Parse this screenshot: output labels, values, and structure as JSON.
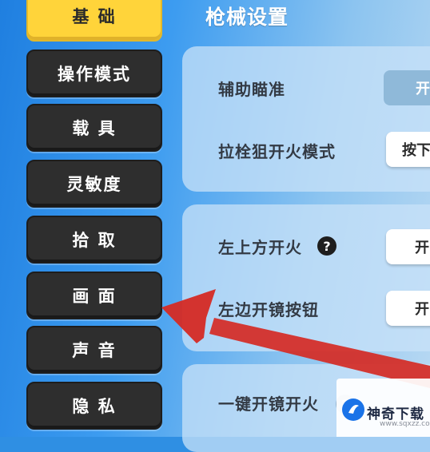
{
  "sidebar": {
    "items": [
      {
        "label": "基 础",
        "active": true
      },
      {
        "label": "操作模式",
        "active": false
      },
      {
        "label": "载 具",
        "active": false
      },
      {
        "label": "灵敏度",
        "active": false
      },
      {
        "label": "拾 取",
        "active": false
      },
      {
        "label": "画 面",
        "active": false
      },
      {
        "label": "声 音",
        "active": false
      },
      {
        "label": "隐 私",
        "active": false
      }
    ]
  },
  "main": {
    "title": "枪械设置",
    "settings": [
      {
        "label": "辅助瞄准",
        "value": "开"
      },
      {
        "label": "拉栓狙开火模式",
        "value": "按下"
      },
      {
        "label": "左上方开火",
        "value": "开"
      },
      {
        "label": "左边开镜按钮",
        "value": "开"
      },
      {
        "label": "一键开镜开火",
        "value": ""
      }
    ],
    "help_glyph": "?"
  },
  "watermark": {
    "text": "神奇下载",
    "url": "www.sqxzz.com"
  },
  "colors": {
    "active_tab": "#ffd43a",
    "inactive_tab": "#2e2e2e",
    "arrow": "#d52a24"
  }
}
